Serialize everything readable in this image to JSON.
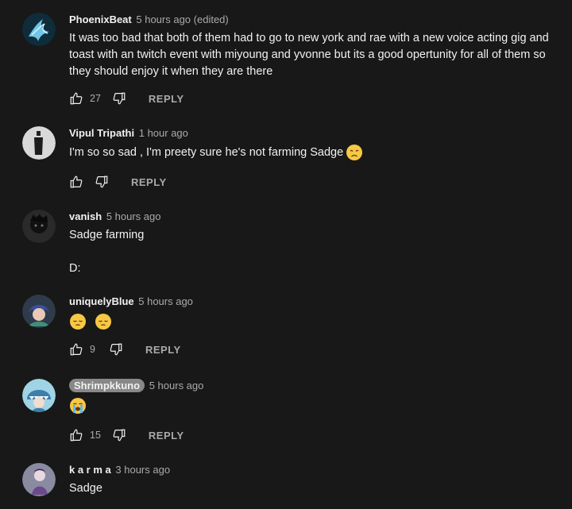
{
  "comments": [
    {
      "author": "PhoenixBeat",
      "time": "5 hours ago (edited)",
      "text": "It was too bad that both of them had to go to new york and rae with a new voice acting gig and toast with an twitch event with miyoung and yvonne but its a good opertunity for all of them so they should enjoy it when they are there",
      "likes": "27",
      "reply_label": "REPLY",
      "avatar_icon": "phoenix-avatar"
    },
    {
      "author": "Vipul Tripathi",
      "time": "1 hour ago",
      "text": "I'm so so sad , I'm preety sure he's not farming Sadge",
      "emoji": "disappointed-face",
      "likes": "",
      "reply_label": "REPLY",
      "avatar_icon": "silhouette-avatar"
    },
    {
      "author": "vanish",
      "time": "5 hours ago",
      "text": "Sadge farming",
      "text2": "D:",
      "avatar_icon": "dark-character-avatar"
    },
    {
      "author": "uniquelyBlue",
      "time": "5 hours ago",
      "emojis": [
        "pensive-face",
        "pensive-face"
      ],
      "likes": "9",
      "reply_label": "REPLY",
      "avatar_icon": "anime-character-avatar"
    },
    {
      "author": "Shrimpkkuno",
      "time": "5 hours ago",
      "emoji": "loudly-crying-face",
      "likes": "15",
      "reply_label": "REPLY",
      "avatar_icon": "shark-hood-avatar"
    },
    {
      "author": "k a r m a",
      "time": "3 hours ago",
      "text": "Sadge",
      "avatar_icon": "purple-character-avatar"
    }
  ],
  "colors": {
    "background": "#181818",
    "text": "#f1f1f1",
    "secondary": "#aaaaaa",
    "badge": "#888888"
  }
}
